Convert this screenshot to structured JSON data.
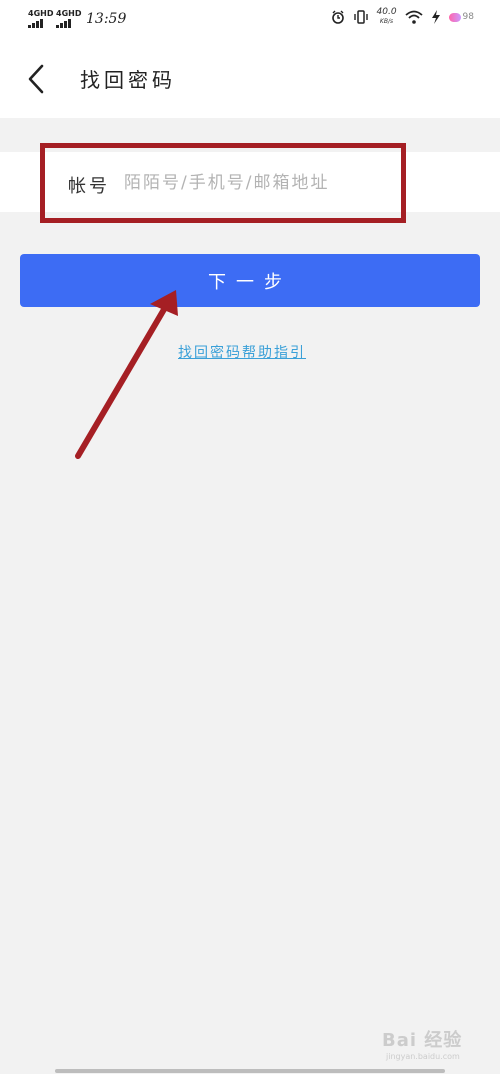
{
  "status_bar": {
    "network_1": "4GHD",
    "network_2": "4GHD",
    "time": "13:59",
    "speed_value": "40.0",
    "speed_unit": "KB/s",
    "battery": "98"
  },
  "header": {
    "title": "找回密码"
  },
  "form": {
    "account_label": "帐号",
    "account_placeholder": "陌陌号/手机号/邮箱地址",
    "account_value": ""
  },
  "actions": {
    "next_label": "下一步",
    "help_link": "找回密码帮助指引"
  },
  "annotation": {
    "box_color": "#a51f24",
    "arrow_color": "#a51f24"
  },
  "watermark": {
    "text": "Bai 经验",
    "sub": "jingyan.baidu.com"
  },
  "colors": {
    "accent": "#3d6cf4",
    "link": "#3aa0d8",
    "background": "#f2f2f2"
  }
}
